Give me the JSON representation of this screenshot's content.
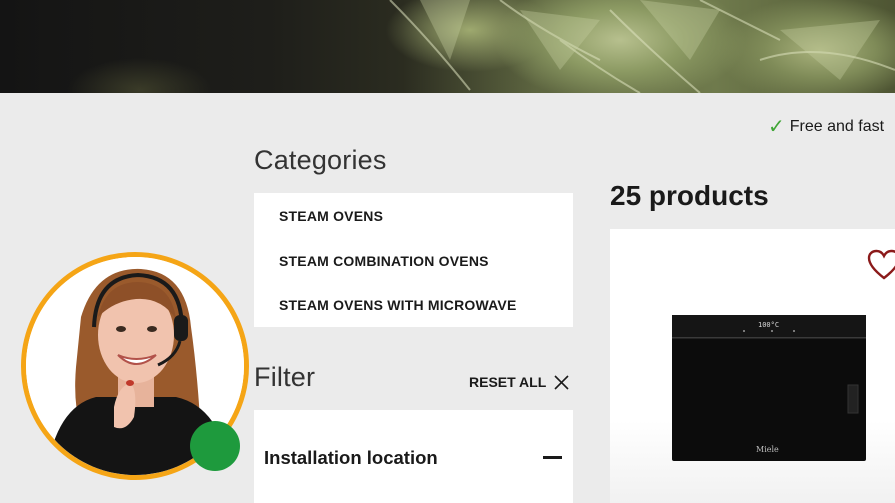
{
  "hero": {
    "image": "artichoke-closeup"
  },
  "promo": {
    "icon": "check-icon",
    "text": "Free and fast"
  },
  "categories": {
    "title": "Categories",
    "items": [
      {
        "label": "STEAM OVENS"
      },
      {
        "label": "STEAM COMBINATION OVENS"
      },
      {
        "label": "STEAM OVENS WITH MICROWAVE"
      }
    ]
  },
  "filter": {
    "title": "Filter",
    "reset_label": "RESET ALL",
    "groups": [
      {
        "label": "Installation location",
        "expanded": true
      }
    ]
  },
  "products": {
    "count_label": "25 products"
  },
  "product_card": {
    "oven_display": "100°C",
    "brand_on_oven": "Miele",
    "favorite_icon": "heart-icon"
  },
  "support": {
    "status": "online",
    "status_color": "#1e9a3d",
    "ring_color": "#f5a516"
  },
  "colors": {
    "accent": "#f5a516",
    "check": "#3fa535",
    "heart": "#8b1a1a"
  }
}
